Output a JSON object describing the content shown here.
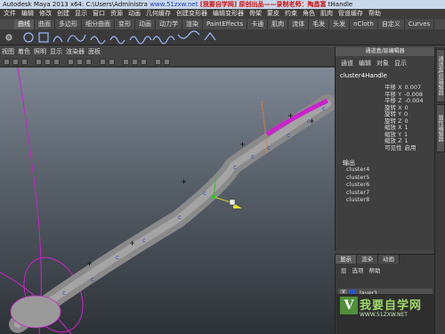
{
  "window": {
    "title_prefix": "Autodesk Maya 2013 x64: C:\\Users\\Administra",
    "title_watermark_url": "www.51zxw.net",
    "title_watermark_note": "[我要自学网] 原创出品——录制老师：陶昌富",
    "title_suffix": "tHandle"
  },
  "menubar": [
    "文件",
    "编辑",
    "修改",
    "创建",
    "显示",
    "窗口",
    "资源",
    "动画",
    "几何缓存",
    "创建变形器",
    "编辑变形器",
    "骨架",
    "蒙皮",
    "约束",
    "角色",
    "肌肉",
    "管道缓存",
    "帮助"
  ],
  "shelf_tabs": [
    {
      "label": "曲线",
      "active": true
    },
    {
      "label": "曲面",
      "active": false
    },
    {
      "label": "多边形",
      "active": false
    },
    {
      "label": "细分曲面",
      "active": false
    },
    {
      "label": "变形",
      "active": false
    },
    {
      "label": "动画",
      "active": false
    },
    {
      "label": "动力学",
      "active": false
    },
    {
      "label": "渲染",
      "active": false
    },
    {
      "label": "PaintEffects",
      "active": false
    },
    {
      "label": "卡通",
      "active": false
    },
    {
      "label": "肌肉",
      "active": false
    },
    {
      "label": "流体",
      "active": false
    },
    {
      "label": "毛发",
      "active": false
    },
    {
      "label": "头发",
      "active": false
    },
    {
      "label": "nCloth",
      "active": false
    },
    {
      "label": "自定义",
      "active": false
    },
    {
      "label": "Curves",
      "active": false
    }
  ],
  "panel_menu": [
    "视图",
    "着色",
    "照明",
    "显示",
    "渲染器",
    "面板"
  ],
  "attribute_editor": {
    "title": "通道盒/层编辑器",
    "menu": [
      "通道",
      "编辑",
      "对象",
      "显示"
    ],
    "node_name": "cluster4Handle",
    "attributes": [
      {
        "label": "平移 X",
        "value": "0.007"
      },
      {
        "label": "平移 Y",
        "value": "-0.008"
      },
      {
        "label": "平移 Z",
        "value": "-0.004"
      },
      {
        "label": "旋转 X",
        "value": "0"
      },
      {
        "label": "旋转 Y",
        "value": "0"
      },
      {
        "label": "旋转 Z",
        "value": "0"
      },
      {
        "label": "缩放 X",
        "value": "1"
      },
      {
        "label": "缩放 Y",
        "value": "1"
      },
      {
        "label": "缩放 Z",
        "value": "1"
      },
      {
        "label": "可见性",
        "value": "启用"
      }
    ],
    "outputs_label": "输出",
    "outputs": [
      "cluster4",
      "cluster5",
      "cluster6",
      "cluster7",
      "cluster8"
    ]
  },
  "side_tabs": [
    "通道盒/层编辑器",
    "属性编辑器"
  ],
  "layer_panel": {
    "tabs": [
      {
        "label": "显示",
        "active": true
      },
      {
        "label": "渲染",
        "active": false
      },
      {
        "label": "动画",
        "active": false
      }
    ],
    "menu": [
      "层",
      "选项",
      "帮助"
    ],
    "layer_name": "layer1",
    "visibility_label": "V"
  },
  "watermark": {
    "logo_letter": "V",
    "text": "我要自学网",
    "url": "WWW.51ZXW.NET"
  },
  "colors": {
    "selection_magenta": "#cc22cc",
    "handle_yellow": "#e8e020",
    "handle_blue": "#2a50d0",
    "handle_green": "#30c030",
    "handle_orange": "#d88040"
  }
}
